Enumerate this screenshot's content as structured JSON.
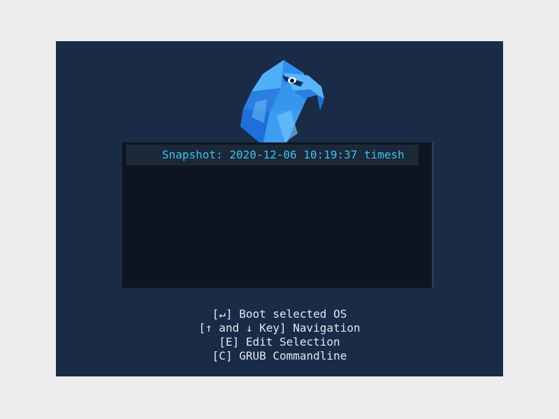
{
  "colors": {
    "page_background": "#ededed",
    "screen_background": "#1a2b47",
    "menu_background": "#0c1520",
    "selected_entry_background": "#1b2838",
    "selected_entry_text": "#3ec1f0",
    "help_text": "#e4e8ee",
    "logo_primary": "#2f8ff0"
  },
  "logo": {
    "icon": "eagle-logo-icon"
  },
  "menu": {
    "entries": [
      {
        "label": "Snapshot: 2020-12-06 10:19:37  timesh",
        "selected": true
      }
    ]
  },
  "help": {
    "lines": [
      "[↵] Boot selected OS",
      "[↑ and ↓ Key] Navigation",
      "[E] Edit Selection",
      "[C] GRUB Commandline"
    ]
  }
}
